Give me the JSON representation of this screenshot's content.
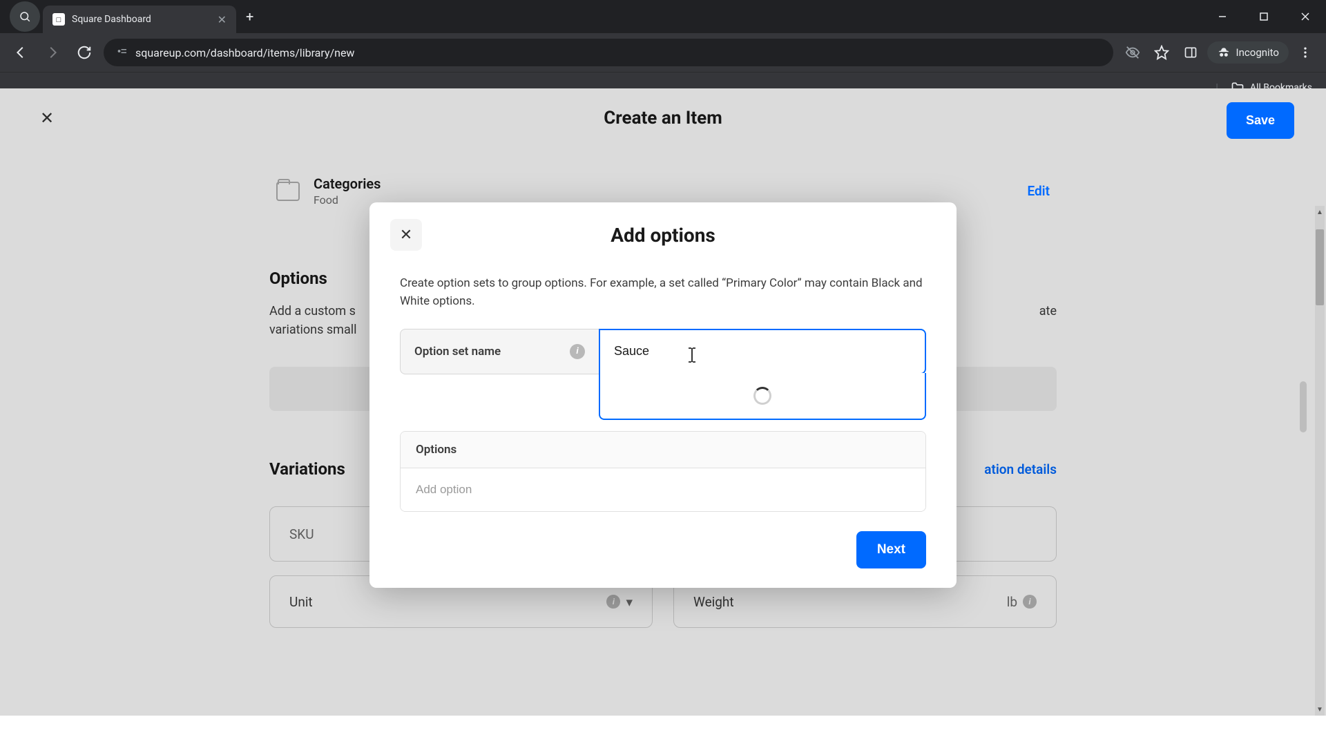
{
  "browser": {
    "tab_title": "Square Dashboard",
    "url": "squareup.com/dashboard/items/library/new",
    "incognito_label": "Incognito",
    "all_bookmarks": "All Bookmarks"
  },
  "page": {
    "title": "Create an Item",
    "save_button": "Save",
    "categories": {
      "label": "Categories",
      "value": "Food",
      "edit": "Edit"
    },
    "options_section": {
      "heading": "Options",
      "desc_fragment": "Add a custom s",
      "desc_fragment2": "variations small",
      "desc_tail": "ate"
    },
    "variations_section": {
      "heading": "Variations",
      "details_link_fragment": "ation details",
      "sku_label": "SKU",
      "unit_label": "Unit",
      "weight_label": "Weight",
      "weight_unit": "lb"
    }
  },
  "modal": {
    "title": "Add options",
    "description": "Create option sets to group options. For example, a set called “Primary Color” may contain Black and White options.",
    "option_set_name_label": "Option set name",
    "option_set_name_value": "Sauce",
    "options_label": "Options",
    "add_option_placeholder": "Add option",
    "next_button": "Next"
  }
}
